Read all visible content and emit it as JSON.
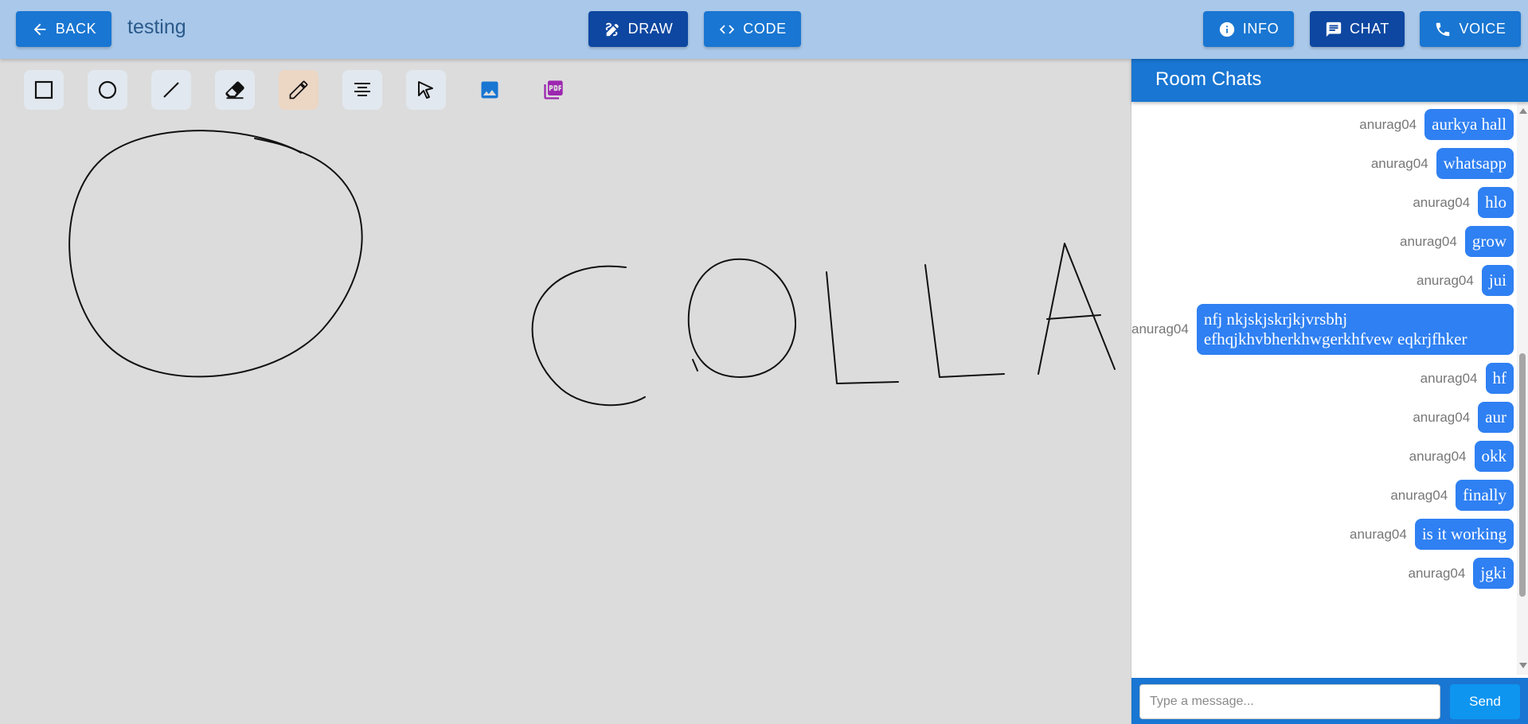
{
  "header": {
    "back_label": "BACK",
    "room_name": "testing",
    "draw_label": "DRAW",
    "code_label": "CODE",
    "info_label": "INFO",
    "chat_label": "CHAT",
    "voice_label": "VOICE"
  },
  "colors": {
    "topbar": "#a9c8ea",
    "primary": "#1976d2",
    "primary_active": "#0d47a1",
    "bubble": "#2f80f2",
    "canvas": "#dcdcdc"
  },
  "toolbar": {
    "tools": [
      {
        "name": "rectangle-icon",
        "active": false
      },
      {
        "name": "circle-icon",
        "active": false
      },
      {
        "name": "line-icon",
        "active": false
      },
      {
        "name": "eraser-icon",
        "active": false
      },
      {
        "name": "pencil-icon",
        "active": true
      },
      {
        "name": "text-align-icon",
        "active": false
      },
      {
        "name": "select-pointer-icon",
        "active": false
      },
      {
        "name": "image-icon",
        "active": false
      },
      {
        "name": "pdf-icon",
        "active": false
      }
    ]
  },
  "canvas": {
    "drawing": "hand-drawn circle and letters",
    "drawn_text": "COLLA"
  },
  "chat": {
    "title": "Room Chats",
    "messages": [
      {
        "user": "anurag04",
        "text": "whatsapp"
      },
      {
        "user": "anurag04",
        "text": "aurkya hall"
      },
      {
        "user": "anurag04",
        "text": "whatsapp"
      },
      {
        "user": "anurag04",
        "text": "hlo"
      },
      {
        "user": "anurag04",
        "text": "grow"
      },
      {
        "user": "anurag04",
        "text": "jui"
      },
      {
        "user": "anurag04",
        "text": "nfj nkjskjskrjkjvrsbhj efhqjkhvbherkhwgerkhfvew eqkrjfhker"
      },
      {
        "user": "anurag04",
        "text": "hf"
      },
      {
        "user": "anurag04",
        "text": "aur"
      },
      {
        "user": "anurag04",
        "text": "okk"
      },
      {
        "user": "anurag04",
        "text": "finally"
      },
      {
        "user": "anurag04",
        "text": "is it working"
      },
      {
        "user": "anurag04",
        "text": "jgki"
      }
    ],
    "input_placeholder": "Type a message...",
    "send_label": "Send"
  }
}
